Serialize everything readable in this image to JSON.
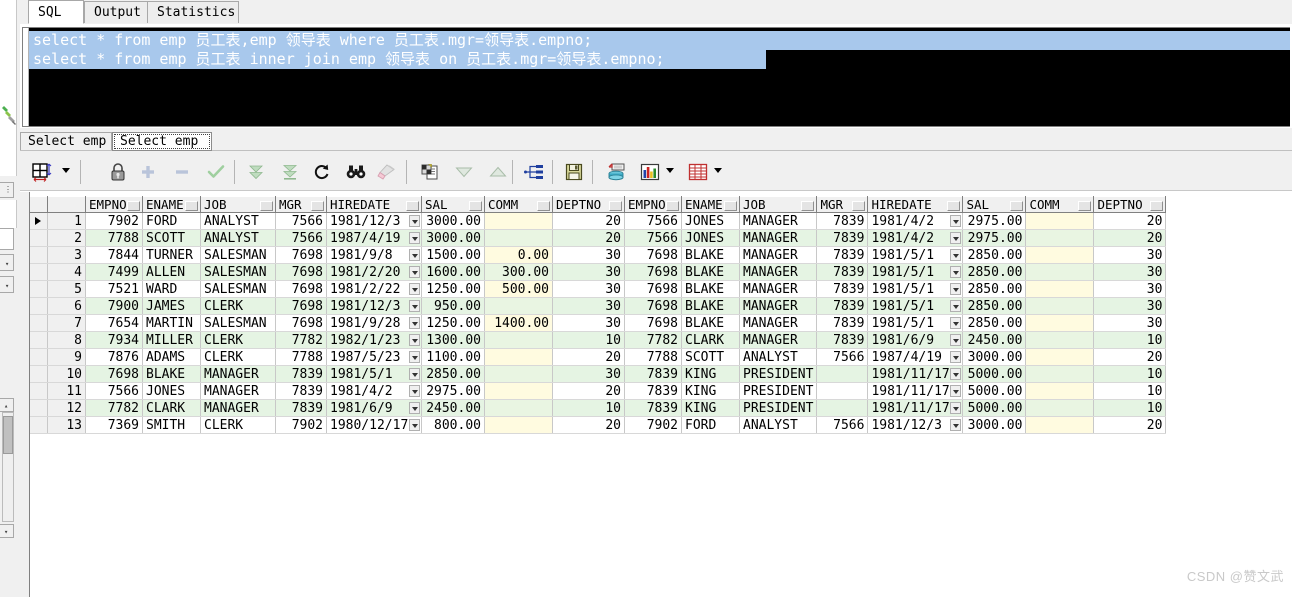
{
  "top_tabs": [
    {
      "label": "SQL",
      "active": true
    },
    {
      "label": "Output",
      "active": false
    },
    {
      "label": "Statistics",
      "active": false
    }
  ],
  "editor": {
    "lines": [
      "select * from emp 员工表,emp 领导表 where 员工表.mgr=领导表.empno;",
      "select * from emp 员工表 inner join emp 领导表 on 员工表.mgr=领导表.empno;"
    ]
  },
  "sheet_tabs": [
    {
      "label": "Select emp",
      "active": false
    },
    {
      "label": "Select emp",
      "active": true
    }
  ],
  "toolbar": {
    "items": [
      {
        "name": "grid-layout-icon",
        "title": "Grid layout"
      },
      {
        "name": "grid-layout-dropdown-caret",
        "title": "Grid layout options"
      },
      {
        "name": "lock-icon",
        "title": "Lock record"
      },
      {
        "name": "add-row-icon",
        "title": "Insert record"
      },
      {
        "name": "remove-row-icon",
        "title": "Delete record"
      },
      {
        "name": "commit-check-icon",
        "title": "Post changes"
      },
      {
        "name": "fetch-all-icon",
        "title": "Fetch all rows"
      },
      {
        "name": "fetch-page-icon",
        "title": "Fetch next page"
      },
      {
        "name": "refresh-icon",
        "title": "Refresh"
      },
      {
        "name": "find-icon",
        "title": "Find"
      },
      {
        "name": "highlight-icon",
        "title": "Highlight"
      },
      {
        "name": "copy-to-clipboard-icon",
        "title": "Copy to clipboard"
      },
      {
        "name": "sort-descending-icon",
        "title": "Sort descending"
      },
      {
        "name": "sort-ascending-icon",
        "title": "Sort ascending"
      },
      {
        "name": "explain-plan-icon",
        "title": "Explain plan"
      },
      {
        "name": "save-icon",
        "title": "Save"
      },
      {
        "name": "export-database-icon",
        "title": "Export data"
      },
      {
        "name": "chart-icon",
        "title": "Chart"
      },
      {
        "name": "chart-dropdown-caret",
        "title": "Chart options"
      },
      {
        "name": "table-view-icon",
        "title": "Table view"
      },
      {
        "name": "table-view-dropdown-caret",
        "title": "Table view options"
      }
    ]
  },
  "grid": {
    "columns": [
      "EMPNO",
      "ENAME",
      "JOB",
      "MGR",
      "HIREDATE",
      "SAL",
      "COMM",
      "DEPTNO",
      "EMPNO",
      "ENAME",
      "JOB",
      "MGR",
      "HIREDATE",
      "SAL",
      "COMM",
      "DEPTNO"
    ],
    "rows": [
      {
        "n": "1",
        "cells": [
          "7902",
          "FORD",
          "ANALYST",
          "7566",
          "1981/12/3",
          "3000.00",
          "",
          "20",
          "7566",
          "JONES",
          "MANAGER",
          "7839",
          "1981/4/2",
          "2975.00",
          "",
          "20"
        ]
      },
      {
        "n": "2",
        "cells": [
          "7788",
          "SCOTT",
          "ANALYST",
          "7566",
          "1987/4/19",
          "3000.00",
          "",
          "20",
          "7566",
          "JONES",
          "MANAGER",
          "7839",
          "1981/4/2",
          "2975.00",
          "",
          "20"
        ]
      },
      {
        "n": "3",
        "cells": [
          "7844",
          "TURNER",
          "SALESMAN",
          "7698",
          "1981/9/8",
          "1500.00",
          "0.00",
          "30",
          "7698",
          "BLAKE",
          "MANAGER",
          "7839",
          "1981/5/1",
          "2850.00",
          "",
          "30"
        ]
      },
      {
        "n": "4",
        "cells": [
          "7499",
          "ALLEN",
          "SALESMAN",
          "7698",
          "1981/2/20",
          "1600.00",
          "300.00",
          "30",
          "7698",
          "BLAKE",
          "MANAGER",
          "7839",
          "1981/5/1",
          "2850.00",
          "",
          "30"
        ]
      },
      {
        "n": "5",
        "cells": [
          "7521",
          "WARD",
          "SALESMAN",
          "7698",
          "1981/2/22",
          "1250.00",
          "500.00",
          "30",
          "7698",
          "BLAKE",
          "MANAGER",
          "7839",
          "1981/5/1",
          "2850.00",
          "",
          "30"
        ]
      },
      {
        "n": "6",
        "cells": [
          "7900",
          "JAMES",
          "CLERK",
          "7698",
          "1981/12/3",
          "950.00",
          "",
          "30",
          "7698",
          "BLAKE",
          "MANAGER",
          "7839",
          "1981/5/1",
          "2850.00",
          "",
          "30"
        ]
      },
      {
        "n": "7",
        "cells": [
          "7654",
          "MARTIN",
          "SALESMAN",
          "7698",
          "1981/9/28",
          "1250.00",
          "1400.00",
          "30",
          "7698",
          "BLAKE",
          "MANAGER",
          "7839",
          "1981/5/1",
          "2850.00",
          "",
          "30"
        ]
      },
      {
        "n": "8",
        "cells": [
          "7934",
          "MILLER",
          "CLERK",
          "7782",
          "1982/1/23",
          "1300.00",
          "",
          "10",
          "7782",
          "CLARK",
          "MANAGER",
          "7839",
          "1981/6/9",
          "2450.00",
          "",
          "10"
        ]
      },
      {
        "n": "9",
        "cells": [
          "7876",
          "ADAMS",
          "CLERK",
          "7788",
          "1987/5/23",
          "1100.00",
          "",
          "20",
          "7788",
          "SCOTT",
          "ANALYST",
          "7566",
          "1987/4/19",
          "3000.00",
          "",
          "20"
        ]
      },
      {
        "n": "10",
        "cells": [
          "7698",
          "BLAKE",
          "MANAGER",
          "7839",
          "1981/5/1",
          "2850.00",
          "",
          "30",
          "7839",
          "KING",
          "PRESIDENT",
          "",
          "1981/11/17",
          "5000.00",
          "",
          "10"
        ]
      },
      {
        "n": "11",
        "cells": [
          "7566",
          "JONES",
          "MANAGER",
          "7839",
          "1981/4/2",
          "2975.00",
          "",
          "20",
          "7839",
          "KING",
          "PRESIDENT",
          "",
          "1981/11/17",
          "5000.00",
          "",
          "10"
        ]
      },
      {
        "n": "12",
        "cells": [
          "7782",
          "CLARK",
          "MANAGER",
          "7839",
          "1981/6/9",
          "2450.00",
          "",
          "10",
          "7839",
          "KING",
          "PRESIDENT",
          "",
          "1981/11/17",
          "5000.00",
          "",
          "10"
        ]
      },
      {
        "n": "13",
        "cells": [
          "7369",
          "SMITH",
          "CLERK",
          "7902",
          "1980/12/17",
          "800.00",
          "",
          "20",
          "7902",
          "FORD",
          "ANALYST",
          "7566",
          "1981/12/3",
          "3000.00",
          "",
          "20"
        ]
      }
    ]
  },
  "watermark": {
    "text": "CSDN @赞文武"
  },
  "colors": {
    "selection": "#a8c8ec",
    "editor_bg": "#000000",
    "row_even": "#e5f4e3",
    "comm_null": "#fffbe0",
    "chrome": "#f0f0f0"
  }
}
